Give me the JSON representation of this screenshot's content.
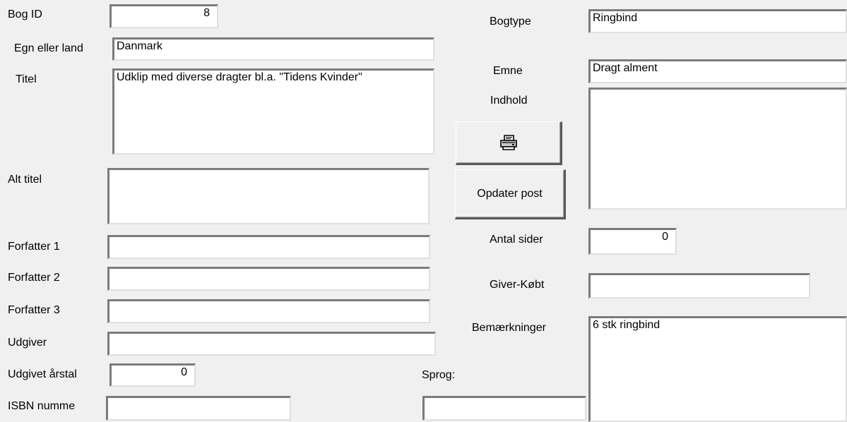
{
  "labels": {
    "bog_id": "Bog ID",
    "egn": "Egn eller land",
    "titel": "Titel",
    "alt_titel": "Alt titel",
    "forfatter1": "Forfatter 1",
    "forfatter2": "Forfatter 2",
    "forfatter3": "Forfatter 3",
    "udgiver": "Udgiver",
    "udgivet_aarstal": "Udgivet årstal",
    "isbn": "ISBN numme",
    "sprog": "Sprog:",
    "bogtype": "Bogtype",
    "emne": "Emne",
    "indhold": "Indhold",
    "antal_sider": "Antal sider",
    "giver_koebt": "Giver-Købt",
    "bemaerkninger": "Bemærkninger"
  },
  "values": {
    "bog_id": "8",
    "egn": "Danmark",
    "titel": "Udklip med diverse dragter bl.a. \"Tidens Kvinder\"",
    "alt_titel": "",
    "forfatter1": "",
    "forfatter2": "",
    "forfatter3": "",
    "udgiver": "",
    "udgivet_aarstal": "0",
    "isbn": "",
    "sprog": "",
    "bogtype": "Ringbind",
    "emne": "Dragt alment",
    "indhold": "",
    "antal_sider": "0",
    "giver_koebt": "",
    "bemaerkninger": "6 stk ringbind"
  },
  "buttons": {
    "print_icon": "printer-icon",
    "opdater": "Opdater post"
  }
}
